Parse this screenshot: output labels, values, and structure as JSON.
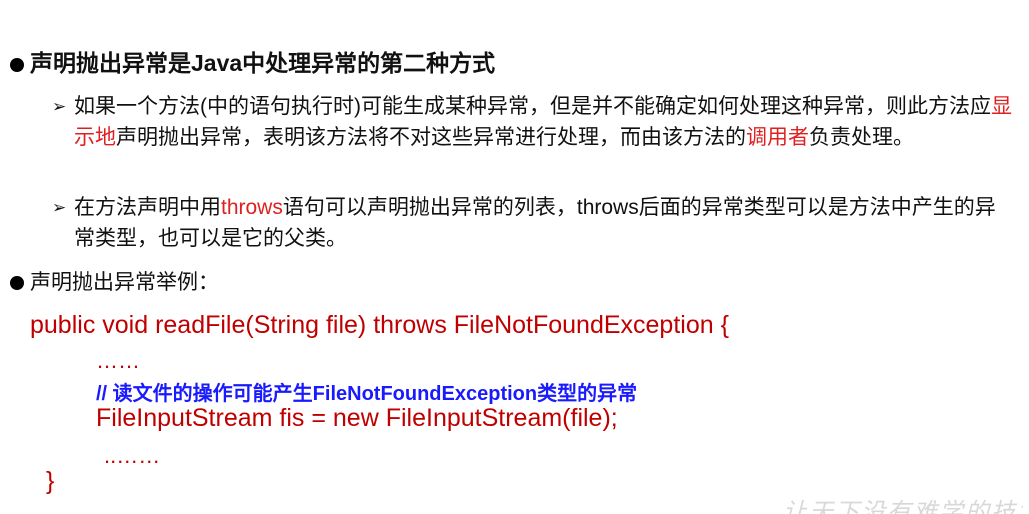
{
  "heading1": "声明抛出异常是Java中处理异常的第二种方式",
  "point1": {
    "part1": "如果一个方法(中的语句执行时)可能生成某种异常，但是并不能确定如何处理这种异常，则此方法应",
    "highlight1": "显示地",
    "part2": "声明抛出异常，表明该方法将不对这些异常进行处理，而由该方法的",
    "highlight2": "调用者",
    "part3": "负责处理。"
  },
  "point2": {
    "part1": "在方法声明中用",
    "highlight1": "throws",
    "part2": "语句可以声明抛出异常的列表，throws后面的异常类型可以是方法中产生的异常类型，也可以是它的父类。"
  },
  "heading2": "声明抛出异常举例：",
  "code": {
    "line1": "public void readFile(String file)  throws FileNotFoundException {",
    "dots1": "……",
    "comment": "// 读文件的操作可能产生FileNotFoundException类型的异常",
    "line3": "FileInputStream fis = new FileInputStream(file);",
    "dots2": "..……",
    "brace": "}"
  },
  "watermark": "让天下没有难学的技术",
  "colors": {
    "highlight": "#e02020",
    "code": "#c00000",
    "comment": "#1a1aff"
  }
}
